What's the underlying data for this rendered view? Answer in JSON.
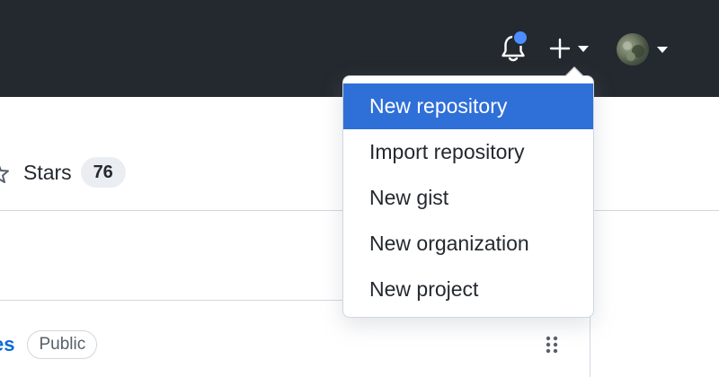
{
  "header": {
    "notifications_icon": "bell-icon",
    "create_icon": "plus-icon",
    "dropdown_icon": "caret-down-icon",
    "unread_indicator_color": "#4c8dff"
  },
  "repo_nav": {
    "stars_label": "Stars",
    "stars_count": "76"
  },
  "repo_list": {
    "name_fragment": "es",
    "visibility_badge": "Public"
  },
  "create_menu": {
    "items": [
      {
        "label": "New repository",
        "highlighted": true
      },
      {
        "label": "Import repository",
        "highlighted": false
      },
      {
        "label": "New gist",
        "highlighted": false
      },
      {
        "label": "New organization",
        "highlighted": false
      },
      {
        "label": "New project",
        "highlighted": false
      }
    ],
    "highlight_color": "#2f6fd8"
  }
}
